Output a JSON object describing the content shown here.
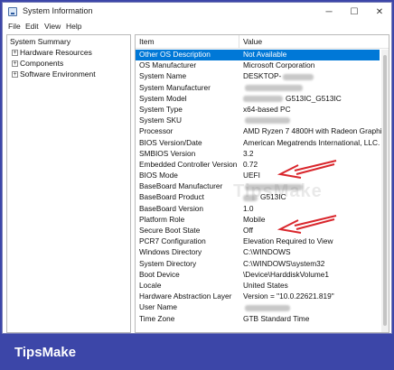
{
  "window": {
    "title": "System Information",
    "minimize_glyph": "─",
    "maximize_glyph": "☐",
    "close_glyph": "✕"
  },
  "menu": [
    "File",
    "Edit",
    "View",
    "Help"
  ],
  "tree": [
    {
      "label": "System Summary",
      "expander": ""
    },
    {
      "label": "Hardware Resources",
      "expander": "+"
    },
    {
      "label": "Components",
      "expander": "+"
    },
    {
      "label": "Software Environment",
      "expander": "+"
    }
  ],
  "list": {
    "columns": [
      "Item",
      "Value"
    ],
    "rows": [
      {
        "item": "Other OS Description",
        "value": "Not Available",
        "selected": true
      },
      {
        "item": "OS Manufacturer",
        "value": "Microsoft Corporation"
      },
      {
        "item": "System Name",
        "value": "DESKTOP-"
      },
      {
        "item": "System Manufacturer",
        "value": ""
      },
      {
        "item": "System Model",
        "value": "G513IC_G513IC"
      },
      {
        "item": "System Type",
        "value": "x64-based PC"
      },
      {
        "item": "System SKU",
        "value": ""
      },
      {
        "item": "Processor",
        "value": "AMD Ryzen 7 4800H with Radeon Graphics, 2"
      },
      {
        "item": "BIOS Version/Date",
        "value": "American Megatrends International, LLC. G5"
      },
      {
        "item": "SMBIOS Version",
        "value": "3.2"
      },
      {
        "item": "Embedded Controller Version",
        "value": "0.72"
      },
      {
        "item": "BIOS Mode",
        "value": "UEFI"
      },
      {
        "item": "BaseBoard Manufacturer",
        "value": ""
      },
      {
        "item": "BaseBoard Product",
        "value": "G513IC"
      },
      {
        "item": "BaseBoard Version",
        "value": "1.0"
      },
      {
        "item": "Platform Role",
        "value": "Mobile"
      },
      {
        "item": "Secure Boot State",
        "value": "Off"
      },
      {
        "item": "PCR7 Configuration",
        "value": "Elevation Required to View"
      },
      {
        "item": "Windows Directory",
        "value": "C:\\WINDOWS"
      },
      {
        "item": "System Directory",
        "value": "C:\\WINDOWS\\system32"
      },
      {
        "item": "Boot Device",
        "value": "\\Device\\HarddiskVolume1"
      },
      {
        "item": "Locale",
        "value": "United States"
      },
      {
        "item": "Hardware Abstraction Layer",
        "value": "Version = \"10.0.22621.819\""
      },
      {
        "item": "User Name",
        "value": ""
      },
      {
        "item": "Time Zone",
        "value": "GTB Standard Time"
      }
    ]
  },
  "watermark": "TipsMake",
  "brand": "TipsMake",
  "colors": {
    "background": "#3c46a8",
    "selection": "#0078d7",
    "arrow": "#d9262c"
  }
}
